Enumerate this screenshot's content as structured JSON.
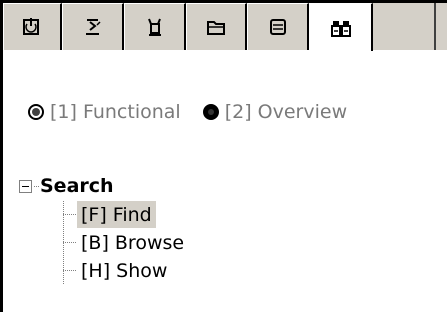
{
  "tabs": [
    {
      "icon": "power-icon"
    },
    {
      "icon": "hourglass-icon"
    },
    {
      "icon": "stand-icon"
    },
    {
      "icon": "folder-icon"
    },
    {
      "icon": "list-icon"
    },
    {
      "icon": "binoculars-icon",
      "active": true
    }
  ],
  "mode": {
    "option1": "[1] Functional",
    "option2": "[2] Overview",
    "selected": 1
  },
  "tree": {
    "root": "Search",
    "items": [
      {
        "label": "[F] Find",
        "selected": true
      },
      {
        "label": "[B] Browse",
        "selected": false
      },
      {
        "label": "[H] Show",
        "selected": false
      }
    ]
  },
  "colors": {
    "tab_bg": "#d4d0c8",
    "selection_bg": "#d4d0c8",
    "radio_text": "#7a7a7a"
  }
}
